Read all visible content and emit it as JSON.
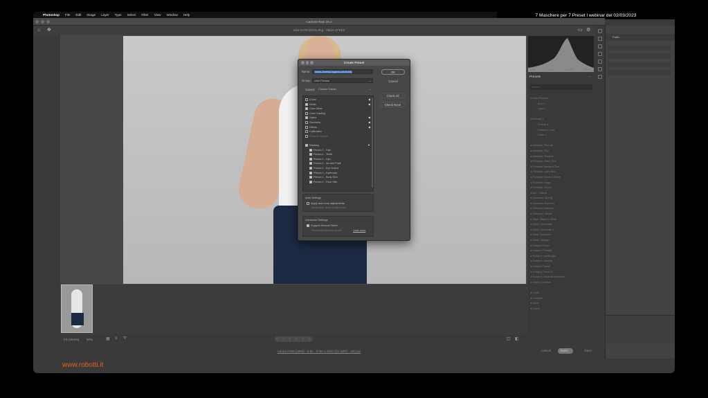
{
  "macos_menu": {
    "apple": "",
    "app": "Photoshop",
    "items": [
      "File",
      "Edit",
      "Image",
      "Layer",
      "Type",
      "Select",
      "Filter",
      "View",
      "Window",
      "Help"
    ]
  },
  "webinar_banner": "7 Maschere per 7 Preset l webinar del 02/03/2023",
  "acr": {
    "window_title": "Camera Raw 15.2",
    "file_line": "Iulia-1079-00101.dng  -  Nikon Z7KE2"
  },
  "canvas": {
    "fit_label": "Fit (19.6%)",
    "zoom_label": "50%",
    "stars": "☆ ☆ ☆ ☆ ☆   ☆"
  },
  "footer": {
    "info": "Adobe RGB (1998) - 8 bit - 5760 x 3840 (22.1MP) - 300 ppi",
    "cancel": "Cancel",
    "done": "Done",
    "open": "Open"
  },
  "brand": "www.robotti.it",
  "histogram": {
    "meta": [
      "f/4.0",
      "1/125s",
      "ISO 100",
      "50 mm"
    ]
  },
  "presets_panel": {
    "title": "Presets",
    "search_placeholder": "Search",
    "items": [
      {
        "label": "▾ User Presets",
        "sub": false
      },
      {
        "label": "Bold 1",
        "sub": true
      },
      {
        "label": "Light 2",
        "sub": true
      },
      {
        "label": "",
        "sub": false
      },
      {
        "label": "▾ Robotti 2",
        "sub": false
      },
      {
        "label": "Portrait 4",
        "sub": true
      },
      {
        "label": "Robotti's Look",
        "sub": true
      },
      {
        "label": "Crack 2",
        "sub": true
      },
      {
        "label": "",
        "sub": false
      },
      {
        "label": "▸ Adaptive: Portrait",
        "sub": false
      },
      {
        "label": "▸ Adaptive: Sky",
        "sub": false
      },
      {
        "label": "▸ Adaptive: Subject",
        "sub": false
      },
      {
        "label": "▸ Portraits: Deep Skin",
        "sub": false
      },
      {
        "label": "▸ Portraits: Medium Skin",
        "sub": false
      },
      {
        "label": "▸ Portraits: Light Skin",
        "sub": false
      },
      {
        "label": "▸ Portraits: Black & White",
        "sub": false
      },
      {
        "label": "▸ Portraits: Edge",
        "sub": false
      },
      {
        "label": "▸ Portraits: Group",
        "sub": false
      },
      {
        "label": "▸ Art: + Warm",
        "sub": false
      },
      {
        "label": "▸ Seasons: Spring",
        "sub": false
      },
      {
        "label": "▸ Seasons: Summer",
        "sub": false
      },
      {
        "label": "▸ Seasons: Autumn",
        "sub": false
      },
      {
        "label": "▸ Seasons: Winter",
        "sub": false
      },
      {
        "label": "▸ Style: Black & White",
        "sub": false
      },
      {
        "label": "▸ Style: Cinematic",
        "sub": false
      },
      {
        "label": "▸ Style: Cinematic II",
        "sub": false
      },
      {
        "label": "▸ Style: Futuristic",
        "sub": false
      },
      {
        "label": "▸ Style: Vintage",
        "sub": false
      },
      {
        "label": "▸ Subject: Food",
        "sub": false
      },
      {
        "label": "▸ Subject: Foliage",
        "sub": false
      },
      {
        "label": "▸ Subject: Landscape",
        "sub": false
      },
      {
        "label": "▸ Subject: Lifestyle",
        "sub": false
      },
      {
        "label": "▸ Subject: Travel",
        "sub": false
      },
      {
        "label": "▸ Subject: Travel II",
        "sub": false
      },
      {
        "label": "▸ Subject: Urban Architecture",
        "sub": false
      },
      {
        "label": "▸ Video: Creative",
        "sub": false
      },
      {
        "label": "",
        "sub": false
      },
      {
        "label": "▸ Color",
        "sub": false
      },
      {
        "label": "▸ Creative",
        "sub": false
      },
      {
        "label": "▸ B&W",
        "sub": false
      },
      {
        "label": "▸ Curve",
        "sub": false
      }
    ]
  },
  "ps_panel": {
    "tab": "Paths"
  },
  "dialog": {
    "title": "Create Preset",
    "name_label": "Name:",
    "name_value": "mask-Amelia-ragazza-occhi-blu",
    "group_label": "Group:",
    "group_value": "User Presets",
    "subset_label": "Subset:",
    "subset_value": "Custom Subset",
    "ok": "OK",
    "cancel": "Cancel",
    "check_all": "Check All",
    "check_none": "Check None",
    "settings": [
      {
        "label": "Curve",
        "state": "off",
        "arrow": "◀",
        "indent": false,
        "dim": false
      },
      {
        "label": "Detail",
        "state": "on",
        "arrow": "◀",
        "indent": false,
        "dim": false
      },
      {
        "label": "Color Mixer",
        "state": "on",
        "arrow": "",
        "indent": false,
        "dim": false
      },
      {
        "label": "Color Grading",
        "state": "off",
        "arrow": "",
        "indent": false,
        "dim": false
      },
      {
        "label": "Optics",
        "state": "on",
        "arrow": "◀",
        "indent": false,
        "dim": false
      },
      {
        "label": "Geometry",
        "state": "off",
        "arrow": "◀",
        "indent": false,
        "dim": false
      },
      {
        "label": "Effects",
        "state": "off",
        "arrow": "◀",
        "indent": false,
        "dim": false
      },
      {
        "label": "Calibration",
        "state": "off",
        "arrow": "",
        "indent": false,
        "dim": false
      },
      {
        "label": "Process Version",
        "state": "off",
        "arrow": "",
        "indent": false,
        "dim": true
      },
      {
        "label": "",
        "state": "none",
        "arrow": "",
        "indent": false,
        "dim": false
      },
      {
        "label": "Masking",
        "state": "on",
        "arrow": "▼",
        "indent": false,
        "dim": false
      },
      {
        "label": "Person 1 - Hair",
        "state": "on",
        "arrow": "",
        "indent": true,
        "dim": false
      },
      {
        "label": "Person 1 - Teeth",
        "state": "on",
        "arrow": "",
        "indent": true,
        "dim": false
      },
      {
        "label": "Person 1 - Lips",
        "state": "on",
        "arrow": "",
        "indent": true,
        "dim": false
      },
      {
        "label": "Person 1 - Iris and Pupil",
        "state": "on",
        "arrow": "",
        "indent": true,
        "dim": false
      },
      {
        "label": "Person 1 - Eye Sclera",
        "state": "on",
        "arrow": "",
        "indent": true,
        "dim": false
      },
      {
        "label": "Person 1 - Eyebrows",
        "state": "on",
        "arrow": "",
        "indent": true,
        "dim": false
      },
      {
        "label": "Person 1 - Body Skin",
        "state": "on",
        "arrow": "",
        "indent": true,
        "dim": false
      },
      {
        "label": "Person 1 - Face Skin",
        "state": "on",
        "arrow": "",
        "indent": true,
        "dim": false
      }
    ],
    "auto_settings": {
      "heading": "Auto Settings",
      "option": "Apply auto tone adjustments",
      "option_checked": false,
      "hint": "Adapts given levels & white levels"
    },
    "advanced_settings": {
      "heading": "Advanced Settings",
      "option": "Support Amount Slider",
      "option_checked": true,
      "hint": "Presets will adjust the amount",
      "learn_more": "Learn more"
    }
  }
}
